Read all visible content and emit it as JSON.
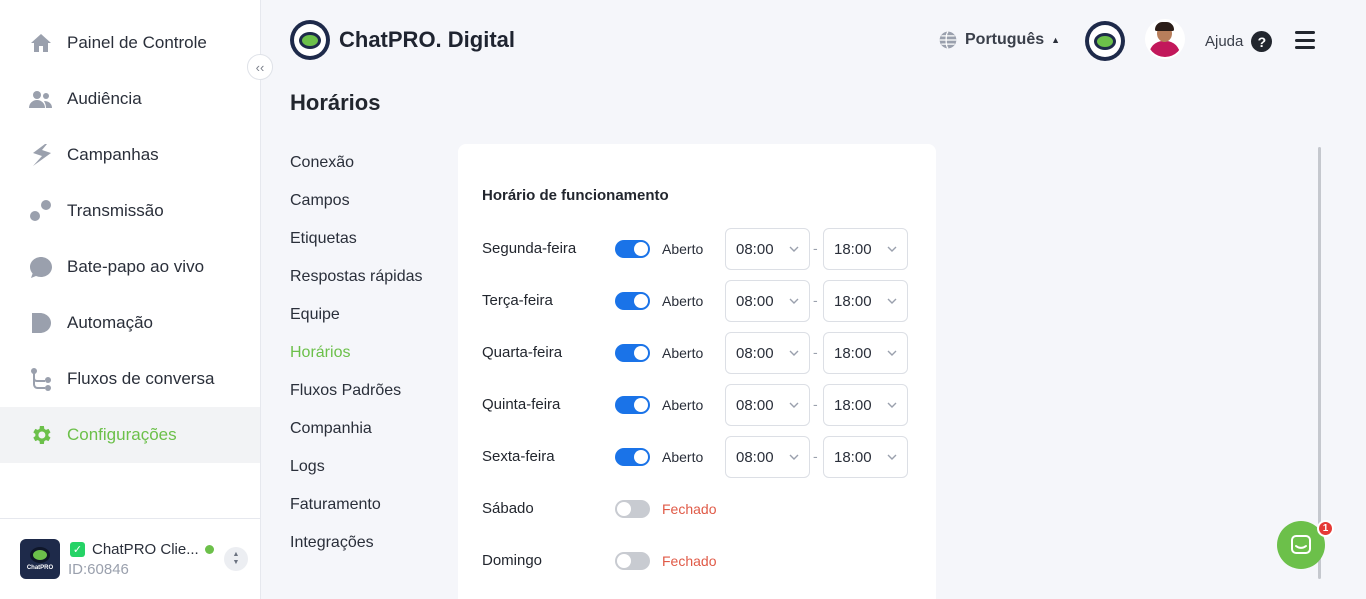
{
  "sidebar": {
    "items": [
      {
        "label": "Painel de Controle",
        "icon": "home-icon"
      },
      {
        "label": "Audiência",
        "icon": "people-icon"
      },
      {
        "label": "Campanhas",
        "icon": "campaign-icon"
      },
      {
        "label": "Transmissão",
        "icon": "broadcast-icon"
      },
      {
        "label": "Bate-papo ao vivo",
        "icon": "chat-bubble-icon"
      },
      {
        "label": "Automação",
        "icon": "automation-icon"
      },
      {
        "label": "Fluxos de conversa",
        "icon": "flow-icon"
      },
      {
        "label": "Configurações",
        "icon": "gear-icon"
      }
    ],
    "active_index": 7,
    "collapse_label": "‹‹",
    "account": {
      "name": "ChatPRO Clie...",
      "id": "ID:60846",
      "logo_text": "ChatPRO"
    }
  },
  "header": {
    "brand": "ChatPRO. Digital",
    "language": "Português",
    "help": "Ajuda",
    "help_icon": "?"
  },
  "page": {
    "title": "Horários"
  },
  "submenu": {
    "items": [
      "Conexão",
      "Campos",
      "Etiquetas",
      "Respostas rápidas",
      "Equipe",
      "Horários",
      "Fluxos Padrões",
      "Companhia",
      "Logs",
      "Faturamento",
      "Integrações"
    ],
    "active_index": 5
  },
  "schedule": {
    "title": "Horário de funcionamento",
    "open_label": "Aberto",
    "closed_label": "Fechado",
    "separator": "-",
    "days": [
      {
        "day": "Segunda-feira",
        "open": true,
        "from": "08:00",
        "to": "18:00"
      },
      {
        "day": "Terça-feira",
        "open": true,
        "from": "08:00",
        "to": "18:00"
      },
      {
        "day": "Quarta-feira",
        "open": true,
        "from": "08:00",
        "to": "18:00"
      },
      {
        "day": "Quinta-feira",
        "open": true,
        "from": "08:00",
        "to": "18:00"
      },
      {
        "day": "Sexta-feira",
        "open": true,
        "from": "08:00",
        "to": "18:00"
      },
      {
        "day": "Sábado",
        "open": false
      },
      {
        "day": "Domingo",
        "open": false
      }
    ]
  },
  "chat_widget": {
    "badge": "1"
  },
  "colors": {
    "accent": "#6cc04a",
    "toggle_on": "#1a73e8",
    "closed": "#e05a47"
  }
}
